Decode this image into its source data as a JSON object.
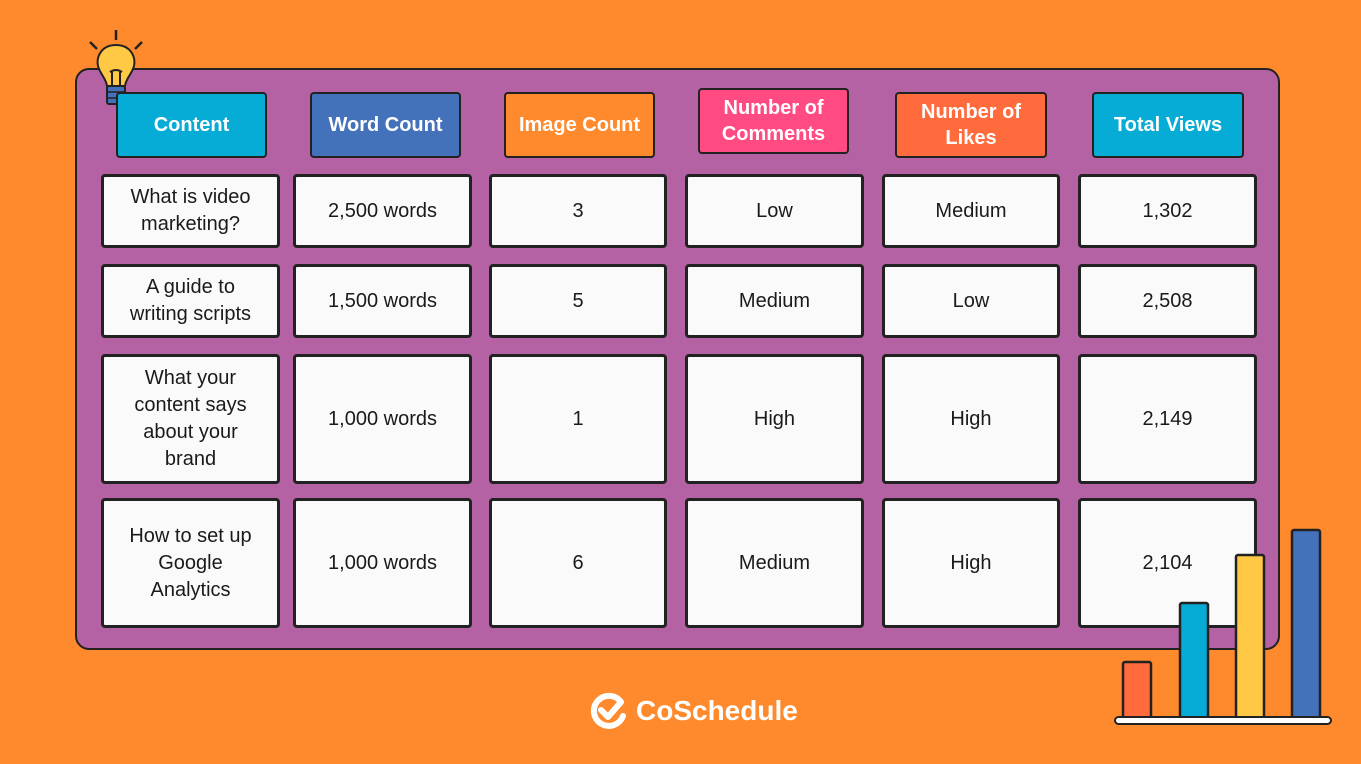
{
  "headers": [
    {
      "label": "Content",
      "color": "#06ABD6"
    },
    {
      "label": "Word Count",
      "color": "#4472BA"
    },
    {
      "label": "Image Count",
      "color": "#FF8A2E"
    },
    {
      "label": "Number of Comments",
      "color": "#FF4B82"
    },
    {
      "label": "Number of Likes",
      "color": "#FF6B3D"
    },
    {
      "label": "Total Views",
      "color": "#06ABD6"
    }
  ],
  "rows": [
    {
      "content": "What is video marketing?",
      "word_count": "2,500 words",
      "image_count": "3",
      "comments": "Low",
      "likes": "Medium",
      "views": "1,302"
    },
    {
      "content": "A guide to writing scripts",
      "word_count": "1,500 words",
      "image_count": "5",
      "comments": "Medium",
      "likes": "Low",
      "views": "2,508"
    },
    {
      "content": "What your content says about your brand",
      "word_count": "1,000 words",
      "image_count": "1",
      "comments": "High",
      "likes": "High",
      "views": "2,149"
    },
    {
      "content": "How to set up Google Analytics",
      "word_count": "1,000 words",
      "image_count": "6",
      "comments": "Medium",
      "likes": "High",
      "views": "2,104"
    }
  ],
  "decorations": {
    "lightbulb_icon": "lightbulb-icon",
    "bar_chart_icon": "bar-chart-icon",
    "bar_colors": [
      "#FF6B3D",
      "#06ABD6",
      "#FFC845",
      "#4472BA"
    ]
  },
  "brand": {
    "name": "CoSchedule",
    "icon": "check-circle-icon"
  }
}
